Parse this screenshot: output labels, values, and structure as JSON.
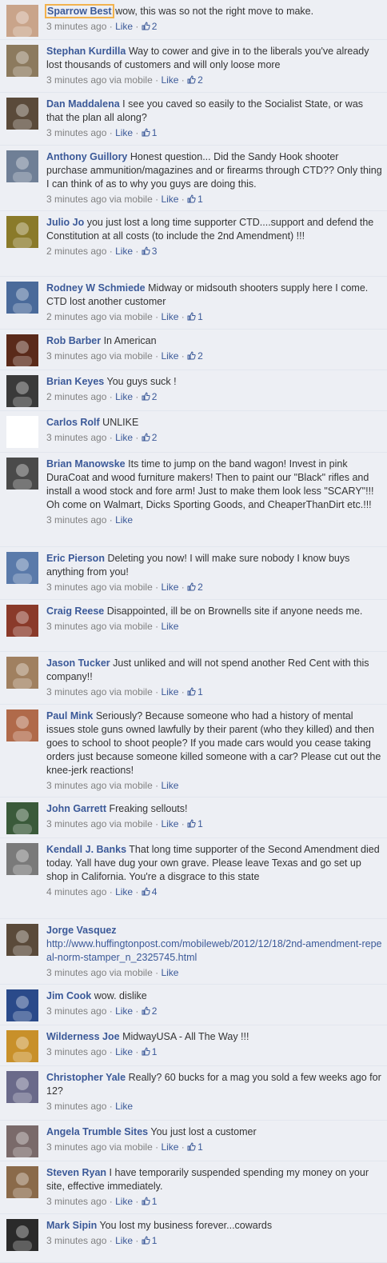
{
  "comments": [
    {
      "author": "Sparrow Best",
      "text": "wow, this was so not the right move to make.",
      "time": "3 minutes ago",
      "via": "",
      "like": "Like",
      "likes": "2",
      "focused": true,
      "avatar": "#c9a48a"
    },
    {
      "author": "Stephan Kurdilla",
      "text": "Way to cower and give in to the liberals you've already lost thousands of customers and will only loose more",
      "time": "3 minutes ago",
      "via": "via mobile",
      "like": "Like",
      "likes": "2",
      "avatar": "#8c7a5e"
    },
    {
      "author": "Dan Maddalena",
      "text": "I see you caved so easily to the Socialist State, or was that the plan all along?",
      "time": "3 minutes ago",
      "via": "",
      "like": "Like",
      "likes": "1",
      "avatar": "#5a4a3a"
    },
    {
      "author": "Anthony Guillory",
      "text": "Honest question... Did the Sandy Hook shooter purchase ammunition/magazines and or firearms through CTD?? Only thing I can think of as to why you guys are doing this.",
      "time": "3 minutes ago",
      "via": "via mobile",
      "like": "Like",
      "likes": "1",
      "avatar": "#6f7f96"
    },
    {
      "author": "Julio Jo",
      "text": "you just lost a long time supporter CTD....support and defend the Constitution at all costs (to include the 2nd Amendment) !!!",
      "time": "2 minutes ago",
      "via": "",
      "like": "Like",
      "likes": "3",
      "avatar": "#8a7a2a"
    },
    {
      "author": "Rodney W Schmiede",
      "text": "Midway or midsouth shooters supply here I come. CTD lost another customer",
      "time": "2 minutes ago",
      "via": "via mobile",
      "like": "Like",
      "likes": "1",
      "avatar": "#4a6a9a"
    },
    {
      "author": "Rob Barber",
      "text": "In American",
      "time": "3 minutes ago",
      "via": "via mobile",
      "like": "Like",
      "likes": "2",
      "avatar": "#5a2a1a"
    },
    {
      "author": "Brian Keyes",
      "text": "You guys suck !",
      "time": "2 minutes ago",
      "via": "",
      "like": "Like",
      "likes": "2",
      "avatar": "#3a3a3a"
    },
    {
      "author": "Carlos Rolf",
      "text": "UNLIKE",
      "time": "3 minutes ago",
      "via": "",
      "like": "Like",
      "likes": "2",
      "avatar": "#ffffff"
    },
    {
      "author": "Brian Manowske",
      "text": "Its time to jump on the band wagon! Invest in pink DuraCoat and wood furniture makers! Then to paint our \"Black\" rifles and install a wood stock and fore arm! Just to make them look less \"SCARY\"!!! Oh come on Walmart, Dicks Sporting Goods, and CheaperThanDirt etc.!!!",
      "time": "3 minutes ago",
      "via": "",
      "like": "Like",
      "likes": "",
      "avatar": "#4a4a4a"
    },
    {
      "author": "Eric Pierson",
      "text": "Deleting you now! I will make sure nobody I know buys anything from you!",
      "time": "3 minutes ago",
      "via": "via mobile",
      "like": "Like",
      "likes": "2",
      "avatar": "#5a7aaa"
    },
    {
      "author": "Craig Reese",
      "text": "Disappointed, ill be on Brownells site if anyone needs me.",
      "time": "3 minutes ago",
      "via": "via mobile",
      "like": "Like",
      "likes": "",
      "avatar": "#8a3a2a"
    },
    {
      "author": "Jason Tucker",
      "text": "Just unliked and will not spend another Red Cent with this company!!",
      "time": "3 minutes ago",
      "via": "via mobile",
      "like": "Like",
      "likes": "1",
      "avatar": "#a08060"
    },
    {
      "author": "Paul Mink",
      "text": "Seriously? Because someone who had a history of mental issues stole guns owned lawfully by their parent (who they killed) and then goes to school to shoot people? If you made cars would you cease taking orders just because someone killed someone with a car? Please cut out the knee-jerk reactions!",
      "time": "3 minutes ago",
      "via": "via mobile",
      "like": "Like",
      "likes": "",
      "avatar": "#b06a4a"
    },
    {
      "author": "John Garrett",
      "text": "Freaking sellouts!",
      "time": "3 minutes ago",
      "via": "via mobile",
      "like": "Like",
      "likes": "1",
      "avatar": "#3a5a3a"
    },
    {
      "author": "Kendall J. Banks",
      "text": "That long time supporter of the Second Amendment died today. Yall have dug your own grave. Please leave Texas and go set up shop in California. You're a disgrace to this state",
      "time": "4 minutes ago",
      "via": "",
      "like": "Like",
      "likes": "4",
      "avatar": "#7a7a7a"
    },
    {
      "author": "Jorge Vasquez",
      "text": "http://www.huffingtonpost.com/mobileweb/2012/12/18/2nd-amendment-repeal-norm-stamper_n_2325745.html",
      "link": true,
      "time": "3 minutes ago",
      "via": "via mobile",
      "like": "Like",
      "likes": "",
      "avatar": "#5a4a3a"
    },
    {
      "author": "Jim Cook",
      "text": "wow. dislike",
      "time": "3 minutes ago",
      "via": "",
      "like": "Like",
      "likes": "2",
      "avatar": "#2a4a8a"
    },
    {
      "author": "Wilderness Joe",
      "text": "MidwayUSA - All The Way !!!",
      "time": "3 minutes ago",
      "via": "",
      "like": "Like",
      "likes": "1",
      "avatar": "#c8902a"
    },
    {
      "author": "Christopher Yale",
      "text": "Really? 60 bucks for a mag you sold a few weeks ago for 12?",
      "time": "3 minutes ago",
      "via": "",
      "like": "Like",
      "likes": "",
      "avatar": "#6a6a8a"
    },
    {
      "author": "Angela Trumble Sites",
      "text": "You just lost a customer",
      "time": "3 minutes ago",
      "via": "via mobile",
      "like": "Like",
      "likes": "1",
      "avatar": "#7a6a6a"
    },
    {
      "author": "Steven Ryan",
      "text": "I have temporarily suspended spending my money on your site, effective immediately.",
      "time": "3 minutes ago",
      "via": "",
      "like": "Like",
      "likes": "1",
      "avatar": "#8a6a4a"
    },
    {
      "author": "Mark Sipin",
      "text": "You lost my business forever...cowards",
      "time": "3 minutes ago",
      "via": "",
      "like": "Like",
      "likes": "1",
      "avatar": "#2a2a2a"
    }
  ]
}
